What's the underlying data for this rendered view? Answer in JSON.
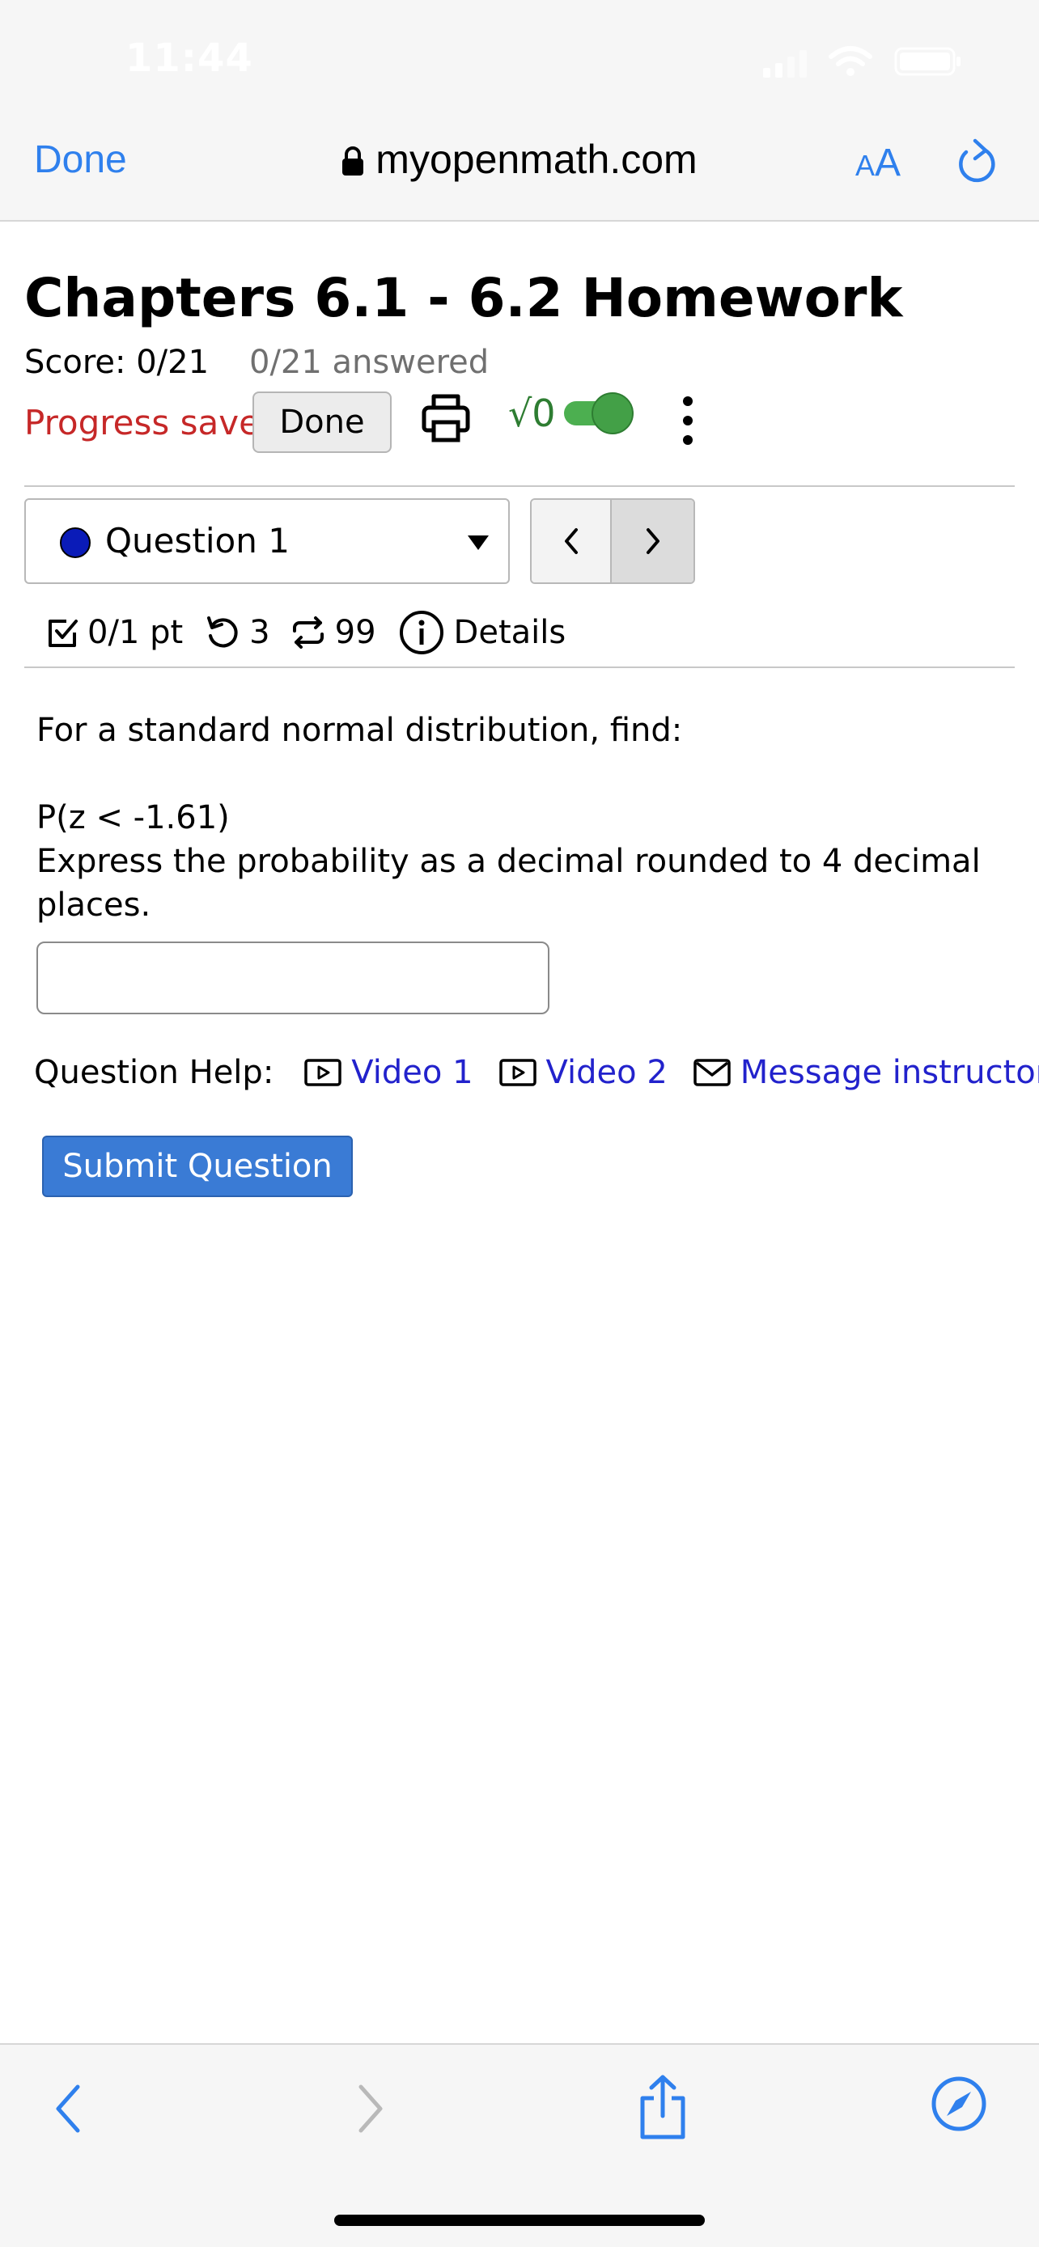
{
  "status_bar": {
    "time": "11:44"
  },
  "browser": {
    "done_label": "Done",
    "url": "myopenmath.com",
    "text_size_small": "A",
    "text_size_big": "A"
  },
  "assignment": {
    "title": "Chapters 6.1 - 6.2 Homework",
    "score": "Score: 0/21",
    "answered": "0/21 answered",
    "progress_status": "Progress saved",
    "done_button": "Done",
    "math_toggle_label": "√0",
    "math_toggle_on": true
  },
  "question_nav": {
    "selected": "Question 1",
    "prev_symbol": "<",
    "next_symbol": ">"
  },
  "question_info": {
    "points": "0/1 pt",
    "tries": "3",
    "versions": "99",
    "details_label": "Details"
  },
  "question": {
    "prompt": "For a standard normal distribution, find:",
    "expression": "P(z < -1.61)",
    "instruction": "Express the probability as a decimal rounded to 4 decimal places.",
    "answer_value": ""
  },
  "help": {
    "label": "Question Help:",
    "links": [
      "Video 1",
      "Video 2",
      "Message instructor"
    ]
  },
  "submit_label": "Submit Question",
  "colors": {
    "accent": "#2f80ed",
    "progress_saved": "#c62828",
    "submit": "#3a7bd5",
    "link": "#2222cc",
    "toggle": "#43a047"
  }
}
